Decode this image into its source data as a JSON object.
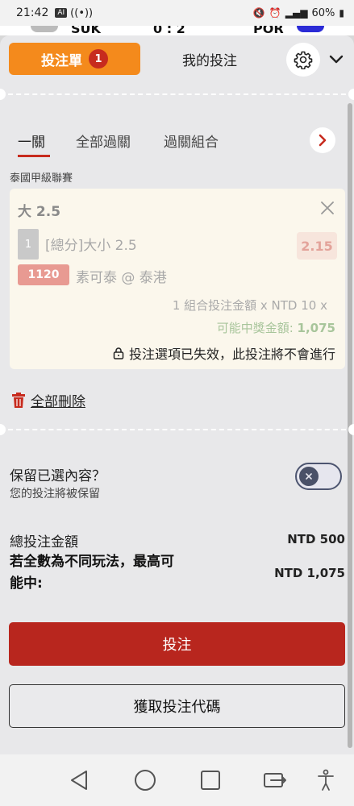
{
  "status_bar": {
    "time": "21:42",
    "ai_badge": "AI",
    "battery": "60%"
  },
  "background_match": {
    "home_team": "SUK",
    "score": "0 : 2",
    "away_team": "POR"
  },
  "header": {
    "betslip_label": "投注單",
    "betslip_count": "1",
    "mybets_label": "我的投注"
  },
  "bet_type_tabs": [
    {
      "label": "一關",
      "active": true
    },
    {
      "label": "全部過關",
      "active": false
    },
    {
      "label": "過關組合",
      "active": false
    }
  ],
  "league": "泰國甲級聯賽",
  "bet": {
    "selection": "大 2.5",
    "leg_number": "1",
    "market": "[總分]大小 2.5",
    "odds": "2.15",
    "match_id": "1120",
    "match": "素可泰 @ 泰港",
    "stake_line": "1 組合投注金額 x NTD 10 x",
    "payout_label": "可能中獎金額: ",
    "payout_value": "1,075",
    "warning": "投注選項已失效，此投注將不會進行"
  },
  "delete_all_label": "全部刪除",
  "keep_selections": {
    "title": "保留已選內容？",
    "subtitle": "您的投注將被保留",
    "enabled": false
  },
  "summary": {
    "total_stake_label": "總投注金額",
    "total_stake_value": "NTD 500",
    "max_win_label": "若全數為不同玩法，最高可能中:",
    "max_win_value": "NTD 1,075"
  },
  "buttons": {
    "place_bet": "投注",
    "get_code": "獲取投注代碼"
  },
  "colors": {
    "accent_orange": "#f48a1c",
    "primary_red": "#b8261e",
    "badge_red": "#c72b1e"
  }
}
